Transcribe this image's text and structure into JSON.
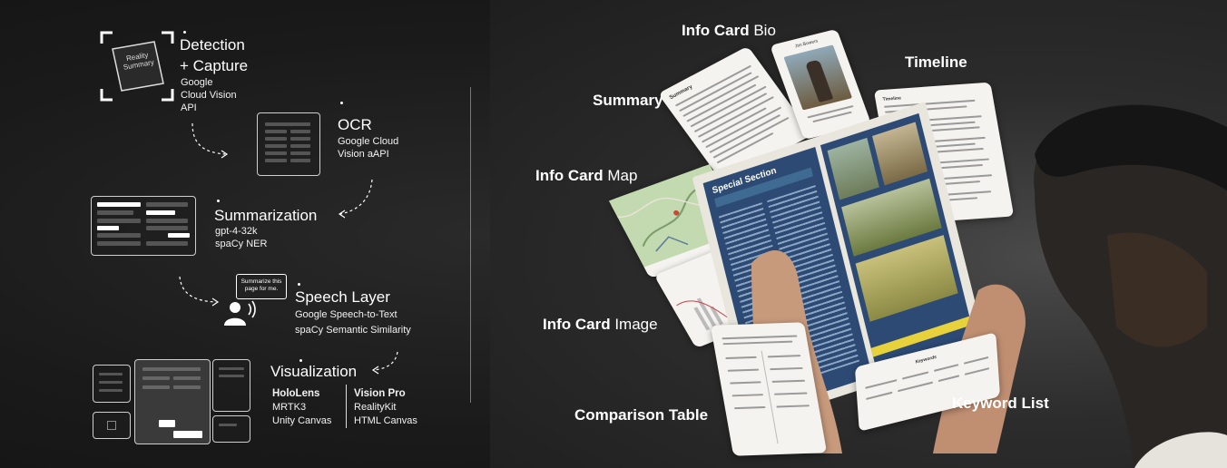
{
  "pipeline": {
    "detection": {
      "title_line1": "Detection",
      "title_line2": "+ Capture",
      "sub1": "Google",
      "sub2": "Cloud Vision",
      "sub3": "API",
      "card_text1": "Reality",
      "card_text2": "Summary"
    },
    "ocr": {
      "title": "OCR",
      "sub1": "Google Cloud",
      "sub2": "Vision aAPI"
    },
    "summarization": {
      "title": "Summarization",
      "sub1": "gpt-4-32k",
      "sub2": "spaCy NER"
    },
    "speech": {
      "title": "Speech Layer",
      "sub1": "Google Speech-to-Text",
      "sub2": "spaCy Semantic Similarity",
      "bubble_line1": "Summarize this",
      "bubble_line2": "page for me."
    },
    "visualization": {
      "title": "Visualization",
      "hololens": {
        "name": "HoloLens",
        "line1": "MRTK3",
        "line2": "Unity Canvas"
      },
      "visionpro": {
        "name": "Vision Pro",
        "line1": "RealityKit",
        "line2": "HTML Canvas"
      }
    }
  },
  "cards": {
    "bio": {
      "bold": "Info Card",
      "rest": " Bio",
      "person_name": "Jim Bowers"
    },
    "summary": {
      "bold": "Summary",
      "card_title": "Summary"
    },
    "timeline": {
      "bold": "Timeline",
      "card_title": "Timeline"
    },
    "map": {
      "bold": "Info Card",
      "rest": " Map"
    },
    "image": {
      "bold": "Info Card",
      "rest": " Image"
    },
    "comparison": {
      "bold": "Comparison Table"
    },
    "keywords": {
      "bold": "Keyword List",
      "card_title": "Keywords"
    }
  },
  "magazine": {
    "section_title": "Special Section"
  },
  "colors": {
    "background": "#1c1c1c",
    "map_green": "#b9d3a6",
    "magazine_blue": "#2c4a74",
    "accent_yellow": "#e8d23c"
  }
}
